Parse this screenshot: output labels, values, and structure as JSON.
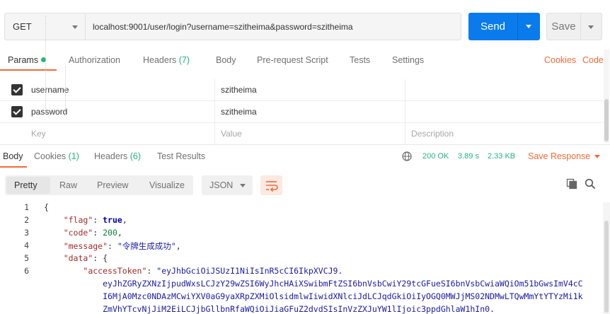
{
  "request": {
    "method": "GET",
    "url": "localhost:9001/user/login?username=szitheima&password=szitheima",
    "send_label": "Send",
    "save_label": "Save"
  },
  "request_tabs": [
    {
      "label": "Params"
    },
    {
      "label": "Authorization"
    },
    {
      "label": "Headers",
      "count": "(7)"
    },
    {
      "label": "Body"
    },
    {
      "label": "Pre-request Script"
    },
    {
      "label": "Tests"
    },
    {
      "label": "Settings"
    }
  ],
  "request_links": {
    "cookies": "Cookies",
    "code": "Code"
  },
  "params": {
    "rows": [
      {
        "checked": true,
        "key": "username",
        "value": "szitheima"
      },
      {
        "checked": true,
        "key": "password",
        "value": "szitheima"
      }
    ],
    "placeholder": {
      "key": "Key",
      "value": "Value",
      "description": "Description"
    }
  },
  "response_tabs": [
    {
      "label": "Body"
    },
    {
      "label": "Cookies",
      "count": "(1)"
    },
    {
      "label": "Headers",
      "count": "(6)"
    },
    {
      "label": "Test Results"
    }
  ],
  "response_status": {
    "status": "200 OK",
    "time": "3.89 s",
    "size": "2.33 KB",
    "save_response": "Save Response"
  },
  "view_modes": [
    "Pretty",
    "Raw",
    "Preview",
    "Visualize"
  ],
  "format": "JSON",
  "code_lines": [
    {
      "n": "1",
      "html": "{"
    },
    {
      "n": "2",
      "html": "    <span class=\"key\">\"flag\"</span>: <span class=\"lit\">true</span>,"
    },
    {
      "n": "3",
      "html": "    <span class=\"key\">\"code\"</span>: <span class=\"num\">200</span>,"
    },
    {
      "n": "4",
      "html": "    <span class=\"key\">\"message\"</span>: <span class=\"str\">\"令牌生成成功\"</span>,"
    },
    {
      "n": "5",
      "html": "    <span class=\"key\">\"data\"</span>: {"
    },
    {
      "n": "6",
      "html": "        <span class=\"key\">\"accessToken\"</span>: <span class=\"str\">\"eyJhbGciOiJSUzI1NiIsInR5cCI6IkpXVCJ9.</span>"
    },
    {
      "n": "",
      "html": "            <span class=\"str\">eyJhZGRyZXNzIjpudWxsLCJzY29wZSI6WyJhcHAiXSwibmFtZSI6bnVsbCwiY29tcGFueSI6bnVsbCwiaWQiOm51bGwsImV4cC</span>"
    },
    {
      "n": "",
      "html": "            <span class=\"str\">I6MjA0Mzc0NDAzMCwiYXV0aG9yaXRpZXMiOlsidmlwIiwidXNlciJdLCJqdGkiOiIyOGQ0MWJjMS02NDMwLTQwMmYtYTYzMi1k</span>"
    },
    {
      "n": "",
      "html": "            <span class=\"str\">ZmVhYTcvNjJiM2EiLCJjbGllbnRfaWQiOiJiaGFuZ2dvdSIsInVzZXJuYW1lIjoic3ppdGhlaW1hIn0.</span>"
    }
  ]
}
